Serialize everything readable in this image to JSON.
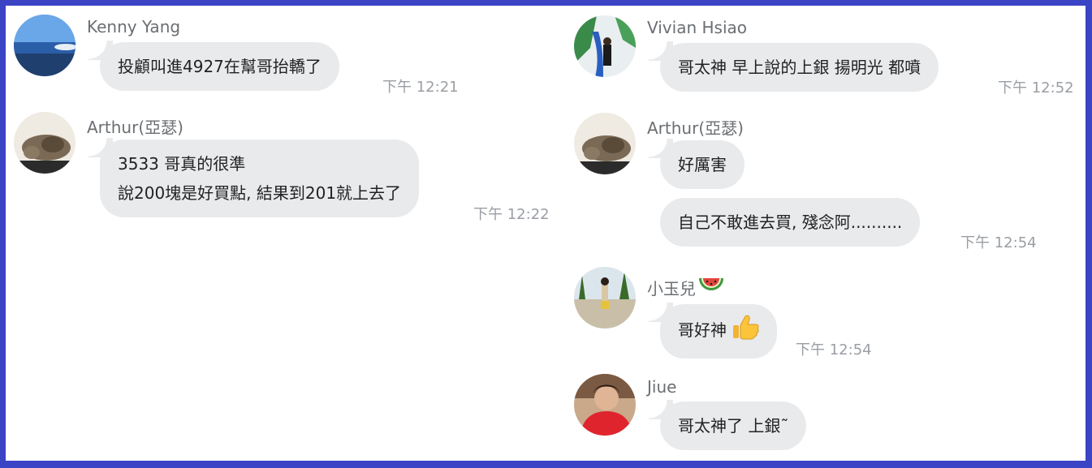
{
  "messages": [
    {
      "sender": "Kenny Yang",
      "text": "投顧叫進4927在幫哥抬轎了",
      "time": "下午 12:21"
    },
    {
      "sender": "Arthur(亞瑟)",
      "lines": [
        "3533 哥真的很準",
        "說200塊是好買點, 結果到201就上去了"
      ],
      "time": "下午 12:22"
    },
    {
      "sender": "Vivian Hsiao",
      "text": "哥太神 早上說的上銀 揚明光 都噴",
      "time": "下午 12:52"
    },
    {
      "sender": "Arthur(亞瑟)",
      "text": "好厲害",
      "text2": "自己不敢進去買, 殘念阿..........",
      "time": "下午 12:54"
    },
    {
      "sender": "小玉兒",
      "text": "哥好神",
      "time": "下午 12:54"
    },
    {
      "sender": "Jiue",
      "text": "哥太神了 上銀˜"
    }
  ],
  "icons": {
    "watermelon": "watermelon-emoji",
    "thumbs_up": "thumbs-up-emoji"
  },
  "colors": {
    "frame_border": "#3b44c4",
    "bubble": "#e8eaec",
    "name_text": "#6b6f73",
    "timestamp": "#9a9ea3"
  }
}
